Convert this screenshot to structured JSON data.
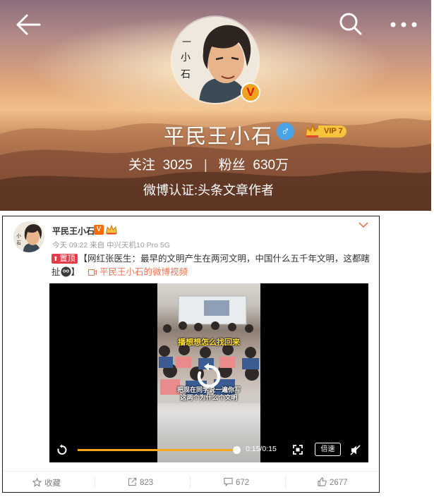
{
  "header": {
    "profile_name": "平民王小石",
    "vip_label": "VIP 7",
    "avatar_badge": "V",
    "following_label": "关注",
    "following_count": "3025",
    "separator": "|",
    "followers_label": "粉丝",
    "followers_count": "630万",
    "verification": "微博认证:头条文章作者"
  },
  "post": {
    "author_name": "平民王小石",
    "author_badge": "V",
    "meta": "今天 09:22 来自 中兴天机10 Pro 5G",
    "pin_label": "置顶",
    "text": "【网红张医生：最早的文明产生在两河文明，中国什么五千年文明，这都瞎扯",
    "text_end": "】",
    "video_link": "平民王小石的微博视频"
  },
  "video": {
    "caption_top": "播想想怎么找回来",
    "caption_bottom": "把现在同学说一遍你写\n这两个为什么个文明",
    "time": "0:15/0:15",
    "speed_label": "倍速",
    "progress": 1.0
  },
  "actions": {
    "favorite_label": "收藏",
    "repost_count": "823",
    "comment_count": "672",
    "like_count": "2677"
  },
  "colors": {
    "accent_orange": "#f7a51c",
    "pin_red": "#e8394a",
    "link_orange": "#eb7350",
    "gender_blue": "#4aa3e4"
  },
  "icons": [
    "back-arrow-icon",
    "search-icon",
    "more-icon",
    "gender-male-icon",
    "vip-crown-icon",
    "pin-icon",
    "emoji-icon",
    "video-icon",
    "replay-icon",
    "fullscreen-icon",
    "mute-icon",
    "star-icon",
    "repost-icon",
    "comment-icon",
    "like-icon",
    "chevron-down-icon"
  ]
}
